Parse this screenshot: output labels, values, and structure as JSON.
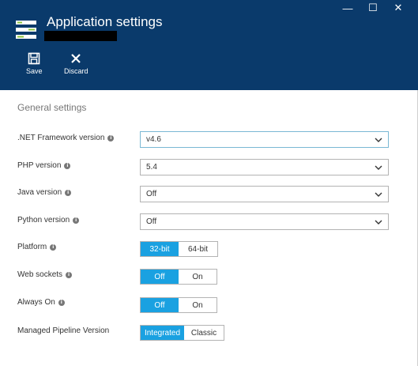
{
  "window": {
    "title": "Application settings",
    "controls": [
      {
        "name": "minimize-icon",
        "glyph": "—"
      },
      {
        "name": "maximize-icon",
        "glyph": "☐"
      },
      {
        "name": "close-icon",
        "glyph": "✕"
      }
    ]
  },
  "toolbar": {
    "save_label": "Save",
    "discard_label": "Discard",
    "save_icon": "save-disk-icon",
    "discard_icon": "close-x-icon"
  },
  "section": {
    "title": "General settings"
  },
  "settings": {
    "net_framework": {
      "label": ".NET Framework version",
      "value": "v4.6"
    },
    "php": {
      "label": "PHP version",
      "value": "5.4"
    },
    "java": {
      "label": "Java version",
      "value": "Off"
    },
    "python": {
      "label": "Python version",
      "value": "Off"
    },
    "platform": {
      "label": "Platform",
      "options": [
        "32-bit",
        "64-bit"
      ],
      "selected": "32-bit"
    },
    "web_sockets": {
      "label": "Web sockets",
      "options": [
        "Off",
        "On"
      ],
      "selected": "Off"
    },
    "always_on": {
      "label": "Always On",
      "options": [
        "Off",
        "On"
      ],
      "selected": "Off"
    },
    "pipeline": {
      "label": "Managed Pipeline Version",
      "options": [
        "Integrated",
        "Classic"
      ],
      "selected": "Integrated"
    }
  },
  "colors": {
    "header_bg": "#0a3a6b",
    "accent": "#1aa1e1",
    "icon_green": "#8cc63e"
  }
}
